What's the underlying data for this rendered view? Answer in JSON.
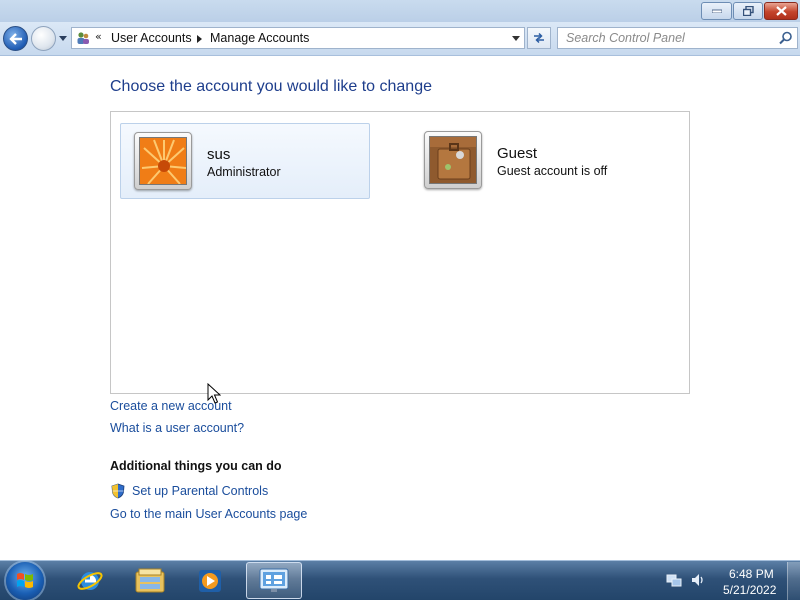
{
  "window": {
    "controls": {
      "minimize": "minimize",
      "maximize": "maximize",
      "close": "close"
    }
  },
  "navigation": {
    "breadcrumb_overflow": "«",
    "breadcrumbs": [
      "User Accounts",
      "Manage Accounts"
    ],
    "search_placeholder": "Search Control Panel"
  },
  "content": {
    "heading": "Choose the account you would like to change",
    "accounts": [
      {
        "name": "sus",
        "type": "Administrator",
        "picture": "orange-flower-icon",
        "selected": true
      },
      {
        "name": "Guest",
        "type": "Guest account is off",
        "picture": "briefcase-icon",
        "selected": false
      }
    ],
    "links": {
      "create": "Create a new account",
      "what_is": "What is a user account?"
    },
    "additional_heading": "Additional things you can do",
    "additional_links": {
      "parental": "Set up Parental Controls",
      "main_page": "Go to the main User Accounts page"
    }
  },
  "taskbar": {
    "items": [
      "start-orb-icon",
      "internet-explorer-icon",
      "windows-explorer-icon",
      "media-player-icon",
      "control-panel-icon"
    ],
    "active_item": "control-panel-icon",
    "clock": {
      "time": "6:48 PM",
      "date": "5/21/2022"
    }
  },
  "colors": {
    "heading": "#1e3e8c",
    "link": "#1a4d9c",
    "taskbar": "#2f5178"
  }
}
